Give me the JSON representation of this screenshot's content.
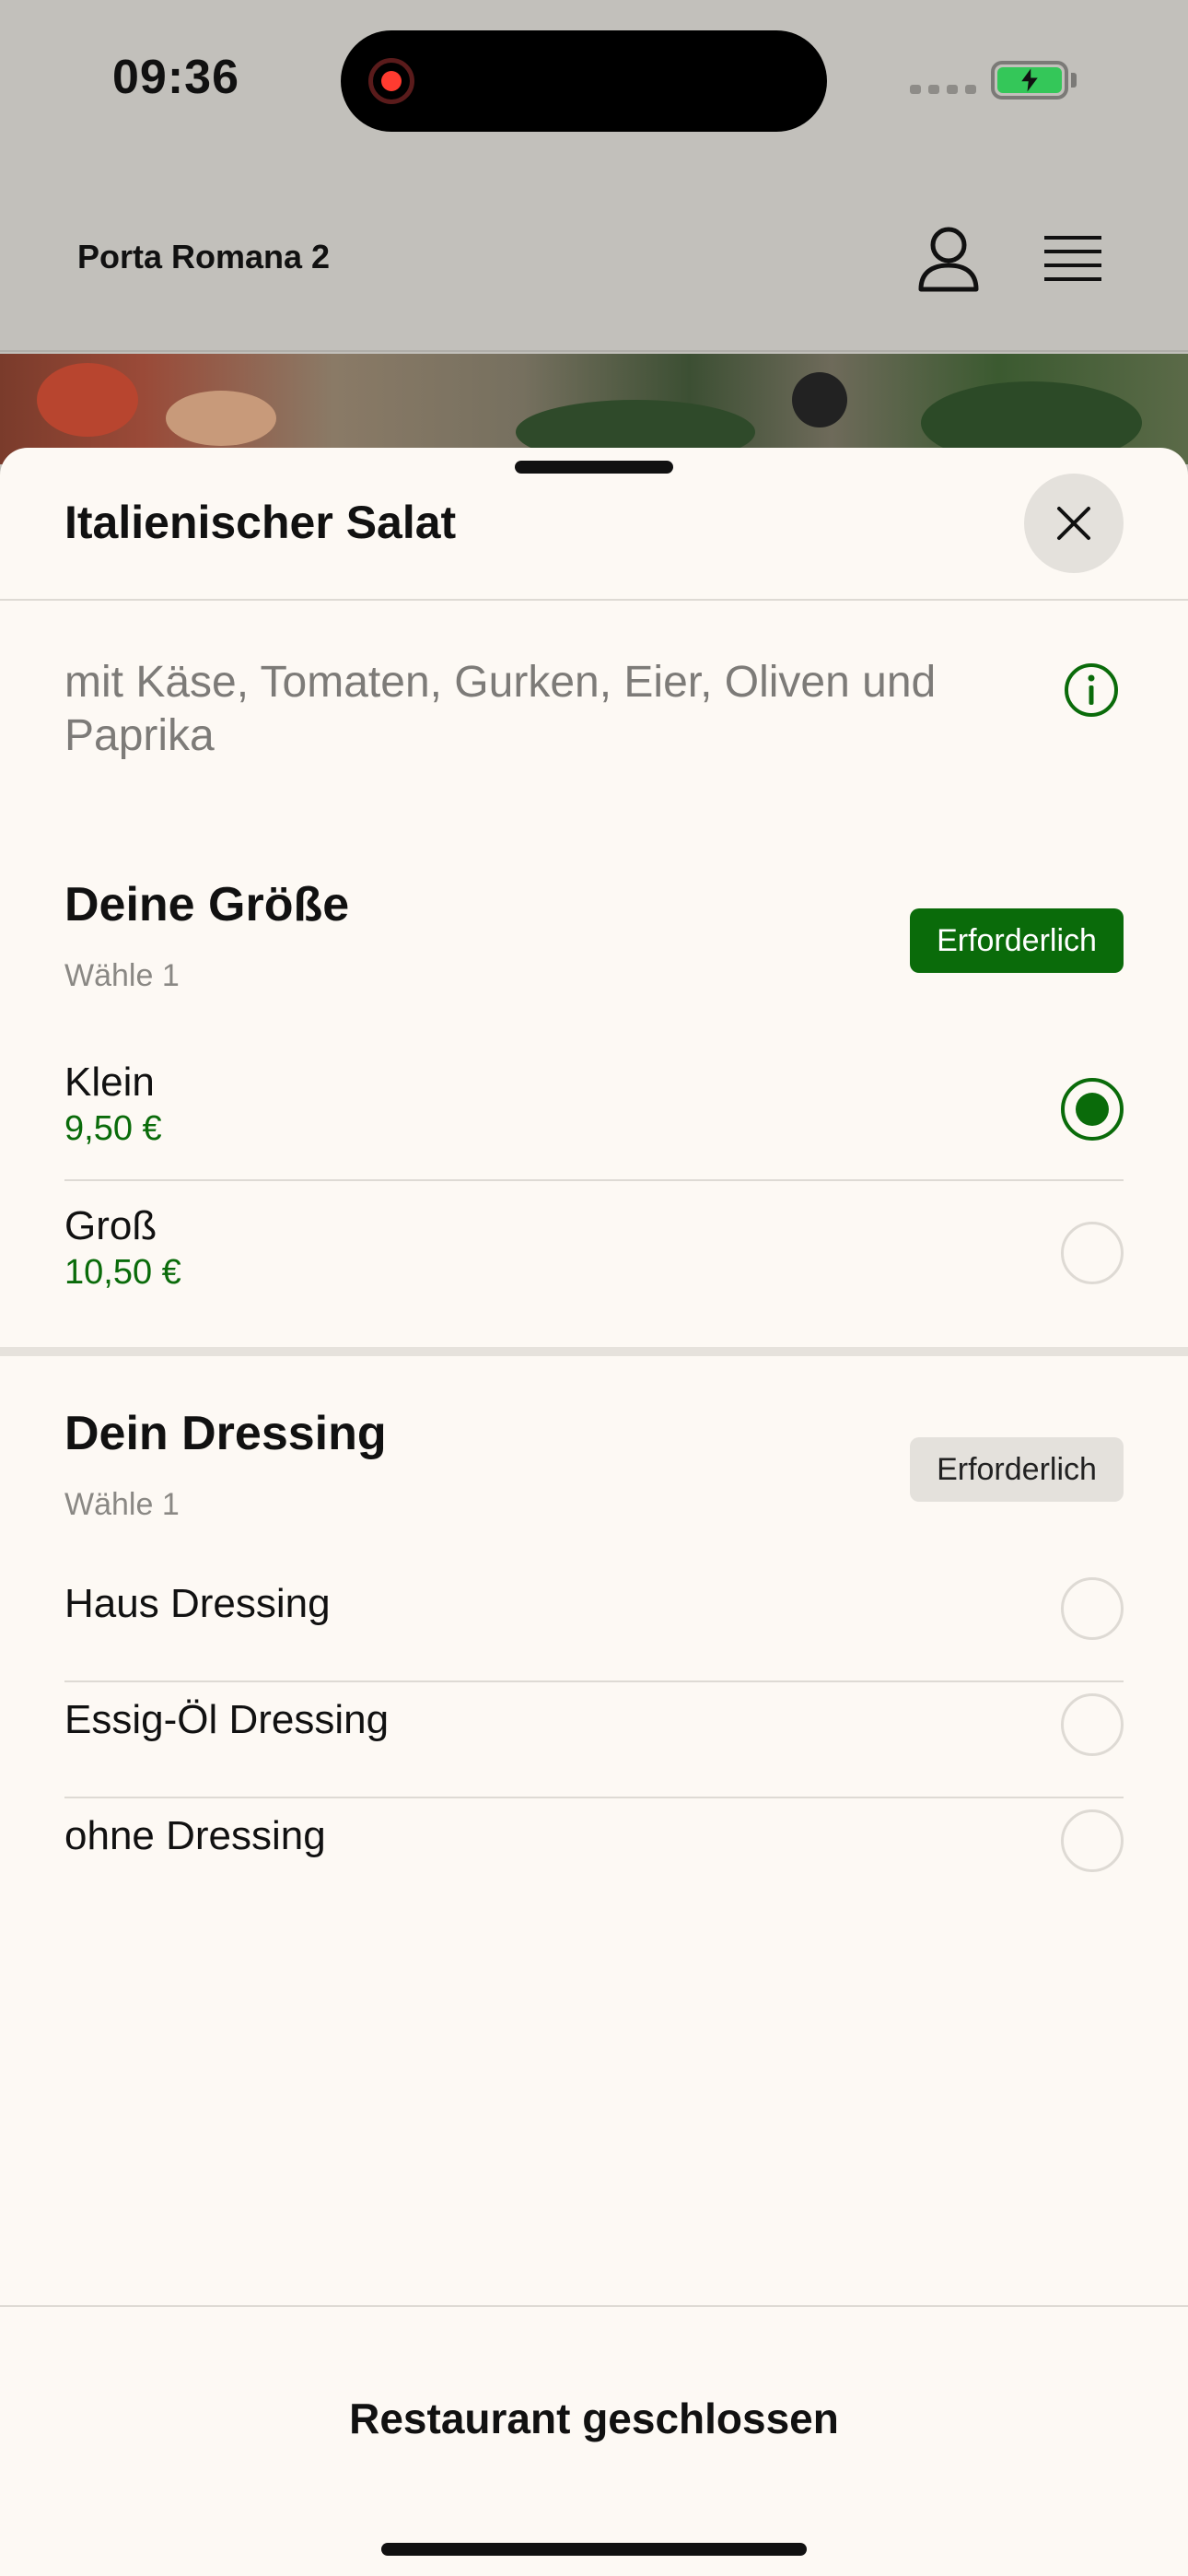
{
  "status_bar": {
    "time": "09:36",
    "icons": [
      "recording-indicator",
      "signal-dots",
      "battery-charging"
    ]
  },
  "header": {
    "store_name": "Porta Romana 2",
    "icons": [
      "profile-icon",
      "menu-icon"
    ]
  },
  "sheet": {
    "title": "Italienischer Salat",
    "description": "mit Käse, Tomaten, Gurken, Eier, Oliven und Paprika",
    "groups": [
      {
        "title": "Deine Größe",
        "subtitle": "Wähle 1",
        "badge": "Erforderlich",
        "options": [
          {
            "name": "Klein",
            "price": "9,50 €",
            "selected": true
          },
          {
            "name": "Groß",
            "price": "10,50 €",
            "selected": false
          }
        ]
      },
      {
        "title": "Dein Dressing",
        "subtitle": "Wähle 1",
        "badge": "Erforderlich",
        "options": [
          {
            "name": "Haus Dressing",
            "selected": false
          },
          {
            "name": "Essig-Öl Dressing",
            "selected": false
          },
          {
            "name": "ohne Dressing",
            "selected": false
          }
        ]
      }
    ],
    "footer_label": "Restaurant geschlossen"
  },
  "colors": {
    "accent": "#0a6b0a",
    "sheet_bg": "#fdf9f4",
    "overlay_bg": "#c2c0bb"
  }
}
